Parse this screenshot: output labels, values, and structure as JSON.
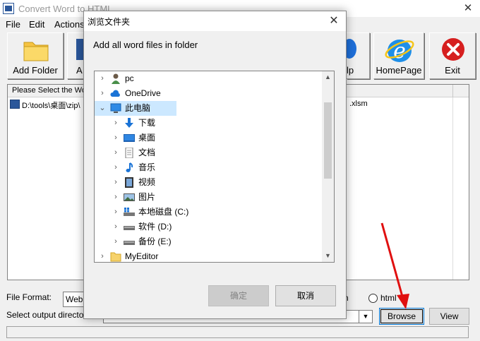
{
  "app": {
    "title": "Convert Word to HTML",
    "close": "✕"
  },
  "menu": [
    "File",
    "Edit",
    "Actions"
  ],
  "toolbar": {
    "add_folder": "Add Folder",
    "add_partial": "A",
    "help_partial": "lp",
    "homepage": "HomePage",
    "exit": "Exit"
  },
  "list": {
    "col1_header": "Please Select the Wo",
    "row1_path": "D:\\tools\\桌面\\zip\\",
    "row1_ext": ".xlsm"
  },
  "bottom": {
    "file_format_label": "File Format:",
    "file_format_value": "Web",
    "output_label": "Select  output directo",
    "radio_htm": "n",
    "radio_html": "html",
    "browse": "Browse",
    "view": "View"
  },
  "dialog": {
    "title": "浏览文件夹",
    "close": "✕",
    "description": "Add all word files in folder",
    "tree": [
      {
        "label": "pc",
        "icon": "user-icon"
      },
      {
        "label": "OneDrive",
        "icon": "cloud-icon"
      },
      {
        "label": "此电脑",
        "icon": "computer-icon"
      },
      {
        "label": "下载",
        "icon": "download-icon"
      },
      {
        "label": "桌面",
        "icon": "desktop-icon"
      },
      {
        "label": "文档",
        "icon": "document-icon"
      },
      {
        "label": "音乐",
        "icon": "music-icon"
      },
      {
        "label": "视频",
        "icon": "video-icon"
      },
      {
        "label": "图片",
        "icon": "picture-icon"
      },
      {
        "label": "本地磁盘 (C:)",
        "icon": "drive-c-icon"
      },
      {
        "label": "软件 (D:)",
        "icon": "drive-icon"
      },
      {
        "label": "备份 (E:)",
        "icon": "drive-icon"
      },
      {
        "label": "MyEditor",
        "icon": "folder-icon"
      }
    ],
    "ok": "确定",
    "cancel": "取消"
  },
  "colors": {
    "accent": "#0078d7",
    "selection": "#cce8ff",
    "arrow": "#e01010"
  }
}
